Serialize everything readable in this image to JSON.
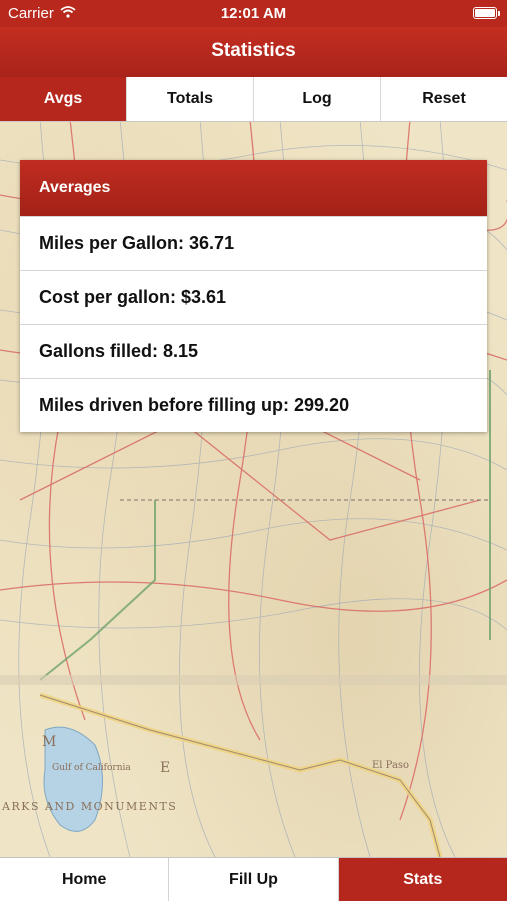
{
  "status_bar": {
    "carrier": "Carrier",
    "time": "12:01 AM"
  },
  "nav": {
    "title": "Statistics"
  },
  "tabs": [
    {
      "label": "Avgs",
      "active": true
    },
    {
      "label": "Totals",
      "active": false
    },
    {
      "label": "Log",
      "active": false
    },
    {
      "label": "Reset",
      "active": false
    }
  ],
  "averages": {
    "title": "Averages",
    "rows": [
      "Miles per Gallon: 36.71",
      "Cost per gallon: $3.61",
      "Gallons filled: 8.15",
      "Miles driven before filling up: 299.20"
    ]
  },
  "map": {
    "legend_heading": "ARKS AND MONUMENTS",
    "gulf_label": "Gulf of California",
    "city_label": "El Paso",
    "region_label": "M",
    "region_label_2": "E"
  },
  "bottom_tabs": [
    {
      "label": "Home",
      "active": false
    },
    {
      "label": "Fill Up",
      "active": false
    },
    {
      "label": "Stats",
      "active": true
    }
  ],
  "colors": {
    "accent": "#b5271c",
    "map_bg": "#efe5c6"
  }
}
